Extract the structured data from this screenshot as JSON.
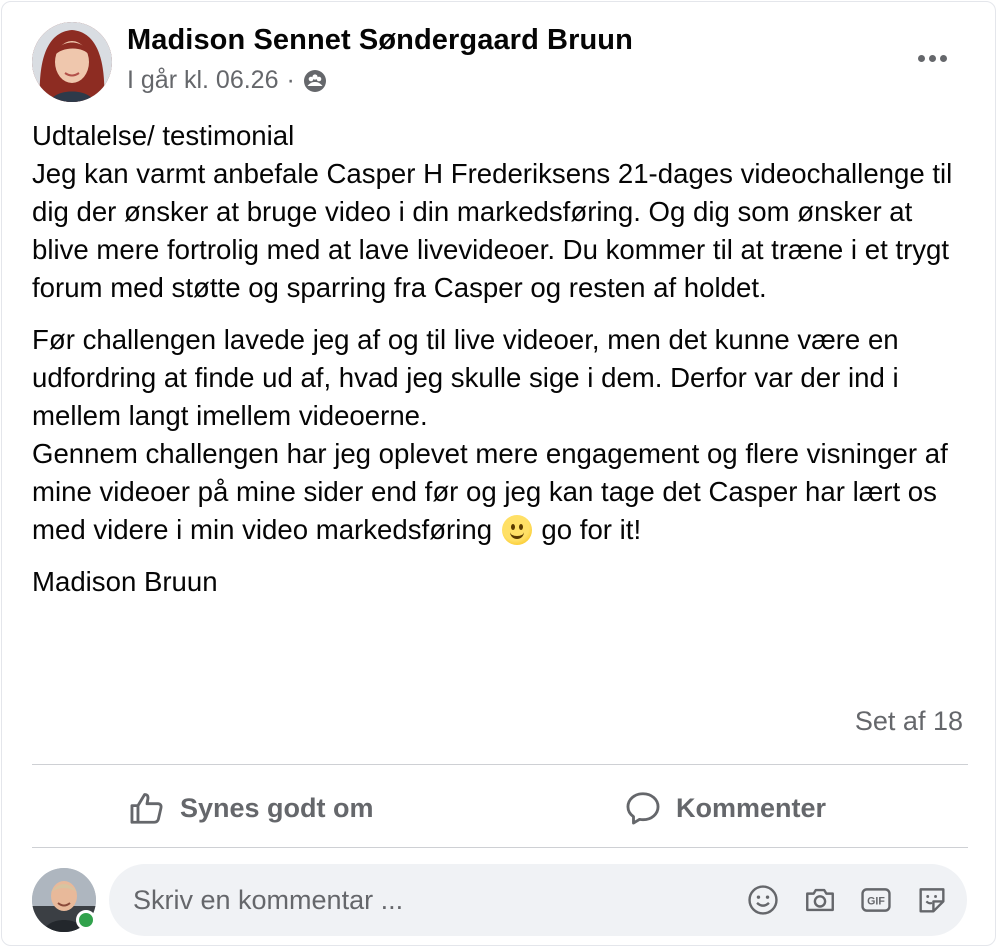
{
  "post": {
    "author": "Madison Sennet Søndergaard Bruun",
    "timestamp": "I går kl. 06.26",
    "separator": "·",
    "audience_icon": "group-audience-icon",
    "more_icon": "more-options-icon",
    "paragraphs": [
      "Udtalelse/ testimonial",
      "Jeg kan varmt anbefale Casper H Frederiksens 21-dages videochallenge til dig der ønsker at bruge video i din markedsføring. Og dig som ønsker at blive mere fortrolig med at lave livevideoer. Du kommer til at træne i et trygt forum med støtte og sparring fra Casper og resten af holdet.",
      "Før challengen lavede jeg af og til live videoer, men det kunne være en udfordring at finde ud af, hvad jeg skulle sige i dem. Derfor var der ind i mellem langt imellem videoerne.",
      "Gennem challengen har jeg oplevet mere engagement og flere visninger af mine videoer på mine sider end før og jeg kan tage det Casper har lært os med videre i min video markedsføring",
      "go for it!",
      "Madison Bruun"
    ],
    "emoji": "slightly-smiling-face-emoji",
    "seen_by": "Set af 18"
  },
  "actions": {
    "like_label": "Synes godt om",
    "comment_label": "Kommenter"
  },
  "comment_box": {
    "placeholder": "Skriv en kommentar ...",
    "value": "",
    "tools": [
      "emoji-icon",
      "camera-icon",
      "gif-icon",
      "sticker-icon"
    ]
  },
  "colors": {
    "text_primary": "#050505",
    "text_secondary": "#65676b",
    "divider": "#ced0d4",
    "input_bg": "#f0f2f5",
    "online": "#31a24c"
  }
}
